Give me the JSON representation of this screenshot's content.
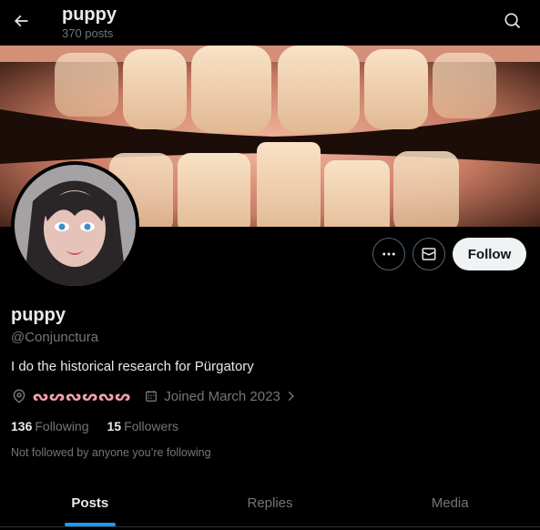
{
  "header": {
    "title": "puppy",
    "post_count": "370 posts"
  },
  "profile": {
    "display_name": "puppy",
    "handle": "@Conjunctura",
    "bio": "I do the historical research for Pürgatory",
    "location": "ᔓᔕᔓᔕᔓᔕ",
    "joined": "Joined March 2023",
    "following_count": "136",
    "following_label": "Following",
    "followers_count": "15",
    "followers_label": "Followers",
    "not_followed_note": "Not followed by anyone you’re following"
  },
  "actions": {
    "follow_label": "Follow"
  },
  "tabs": [
    {
      "label": "Posts",
      "active": true
    },
    {
      "label": "Replies",
      "active": false
    },
    {
      "label": "Media",
      "active": false
    }
  ],
  "colors": {
    "accent": "#1d9bf0",
    "location_text": "#f4a0b0",
    "muted": "#71767b"
  },
  "icons": [
    "back-arrow-icon",
    "search-icon",
    "more-icon",
    "message-icon",
    "location-icon",
    "calendar-icon",
    "chevron-right-icon"
  ]
}
